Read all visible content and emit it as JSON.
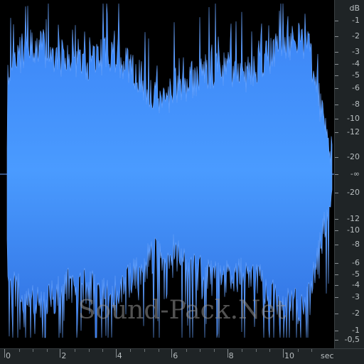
{
  "waveform": {
    "fill_color": "#3f8cff",
    "stroke_color": "#6aa5ff",
    "background": "#000000",
    "duration_sec": 11.4
  },
  "db_ruler": {
    "unit": "dB",
    "labels_top": [
      "-1",
      "-2",
      "-3",
      "-4",
      "-5",
      "-6",
      "-8",
      "-10",
      "-12",
      "-20"
    ],
    "center": "-∞",
    "labels_bottom": [
      "-20",
      "-12",
      "-10",
      "-8",
      "-6",
      "-5",
      "-4",
      "-3",
      "-2",
      "-1",
      "-0,5"
    ]
  },
  "time_ruler": {
    "unit": "sec",
    "labels": [
      "0",
      "2",
      "4",
      "6",
      "8",
      "10"
    ]
  },
  "watermark": {
    "text": "Sound-Pack.Net"
  }
}
